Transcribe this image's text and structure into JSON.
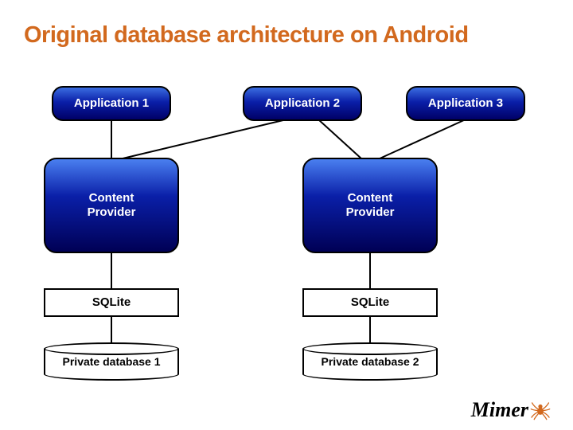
{
  "title": "Original database architecture on Android",
  "apps": {
    "app1": "Application 1",
    "app2": "Application 2",
    "app3": "Application 3"
  },
  "content_providers": {
    "cp1": "Content\nProvider",
    "cp2": "Content\nProvider"
  },
  "sqlite": {
    "s1": "SQLite",
    "s2": "SQLite"
  },
  "databases": {
    "db1": "Private database 1",
    "db2": "Private database 2"
  },
  "logo": {
    "text": "Mimer"
  }
}
